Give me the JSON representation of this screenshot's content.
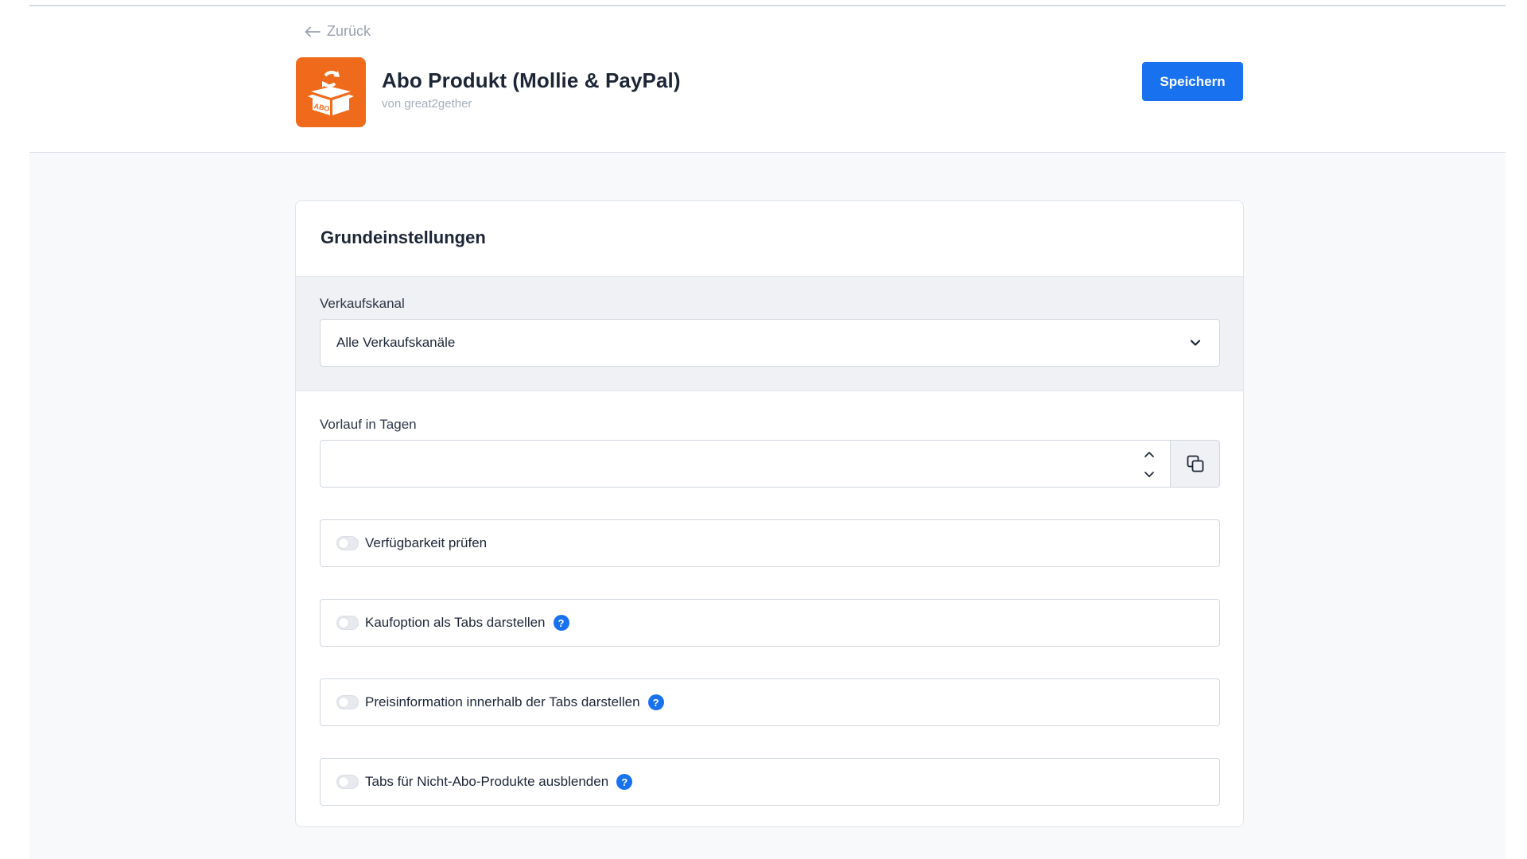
{
  "header": {
    "back_label": "Zurück",
    "title": "Abo Produkt (Mollie & PayPal)",
    "subtitle": "von great2gether",
    "save_label": "Speichern",
    "icon_badge": "ABO",
    "brand_color": "#f06a1c",
    "accent_color": "#1872f0"
  },
  "card": {
    "title": "Grundeinstellungen",
    "sales_channel": {
      "label": "Verkaufskanal",
      "selected": "Alle Verkaufskanäle"
    },
    "lead_time": {
      "label": "Vorlauf in Tagen",
      "value": ""
    },
    "toggles": [
      {
        "label": "Verfügbarkeit prüfen",
        "checked": false,
        "help": false
      },
      {
        "label": "Kaufoption als Tabs darstellen",
        "checked": false,
        "help": true
      },
      {
        "label": "Preisinformation innerhalb der Tabs darstellen",
        "checked": false,
        "help": true
      },
      {
        "label": "Tabs für Nicht-Abo-Produkte ausblenden",
        "checked": false,
        "help": true
      }
    ],
    "help_glyph": "?"
  }
}
